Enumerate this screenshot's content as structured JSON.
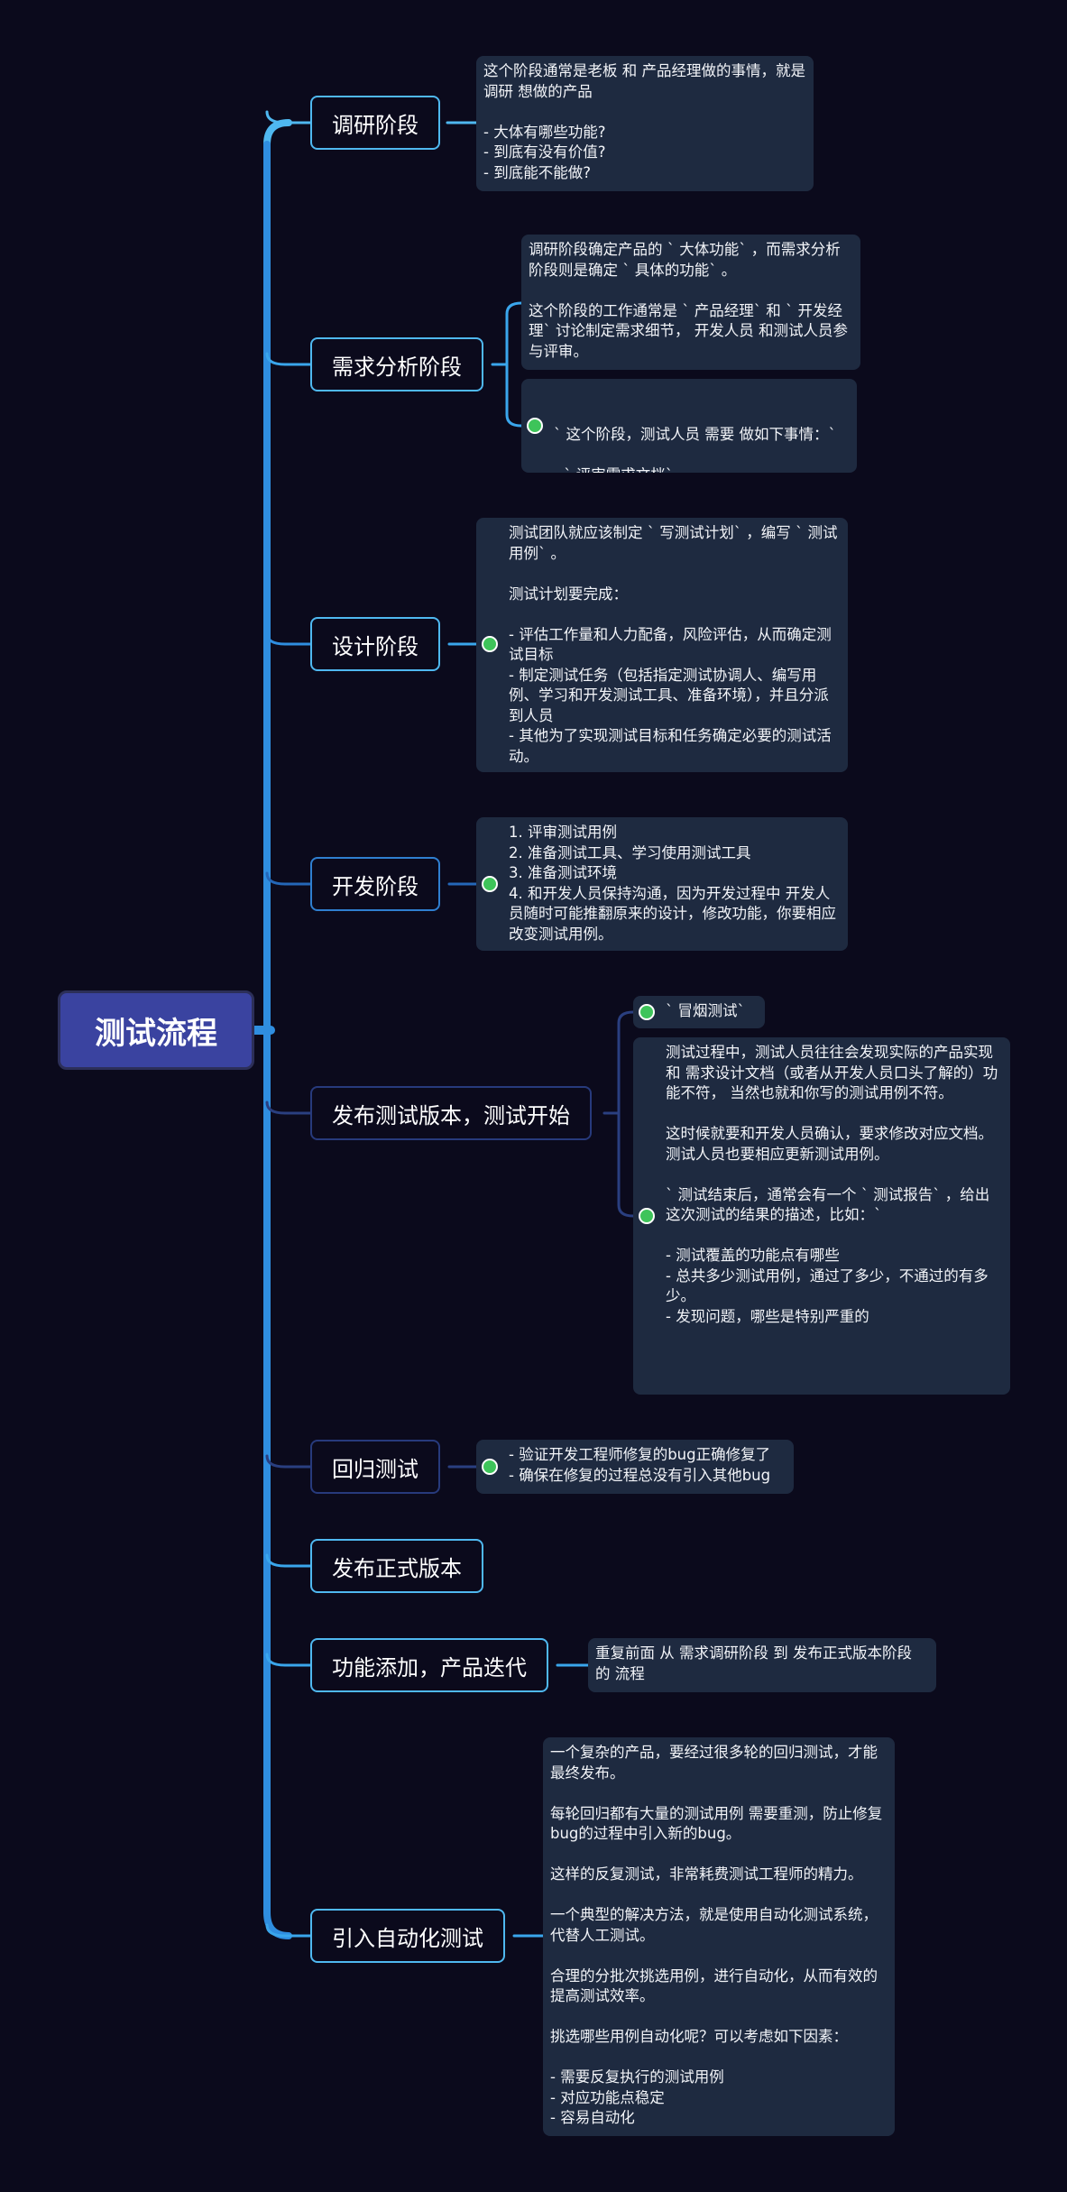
{
  "root": {
    "title": "测试流程"
  },
  "stages": [
    {
      "label": "调研阶段",
      "notes": [
        {
          "text": "这个阶段通常是老板 和 产品经理做的事情，就是调研 想做的产品\n\n- 大体有哪些功能?\n- 到底有没有价值?\n- 到底能不能做?",
          "marker": false
        }
      ]
    },
    {
      "label": "需求分析阶段",
      "notes": [
        {
          "text": "调研阶段确定产品的 ` 大体功能` ，而需求分析阶段则是确定 ` 具体的功能` 。\n\n这个阶段的工作通常是 ` 产品经理` 和 ` 开发经理` 讨论制定需求细节， 开发人员 和测试人员参与评审。",
          "marker": false
        },
        {
          "text": "` 这个阶段，测试人员 需要 做如下事情：`\n\n- ` 评审需求文档`\n- ` 整理测试需求`",
          "marker": true
        }
      ]
    },
    {
      "label": "设计阶段",
      "notes": [
        {
          "text": "测试团队就应该制定 ` 写测试计划` ，编写 ` 测试用例` 。\n\n测试计划要完成：\n\n- 评估工作量和人力配备，风险评估，从而确定测试目标\n- 制定测试任务（包括指定测试协调人、编写用例、学习和开发测试工具、准备环境），并且分派到人员\n- 其他为了实现测试目标和任务确定必要的测试活动。",
          "marker": true
        }
      ]
    },
    {
      "label": "开发阶段",
      "notes": [
        {
          "text": "1. 评审测试用例\n2. 准备测试工具、学习使用测试工具\n3. 准备测试环境\n4. 和开发人员保持沟通，因为开发过程中 开发人员随时可能推翻原来的设计，修改功能，你要相应改变测试用例。",
          "marker": true
        }
      ]
    },
    {
      "label": "发布测试版本，测试开始",
      "notes": [
        {
          "text": "` 冒烟测试`",
          "marker": true
        },
        {
          "text": "测试过程中，测试人员往往会发现实际的产品实现 和 需求设计文档（或者从开发人员口头了解的）功能不符， 当然也就和你写的测试用例不符。\n\n这时候就要和开发人员确认，要求修改对应文档。测试人员也要相应更新测试用例。\n\n` 测试结束后，通常会有一个 ` 测试报告` ，给出这次测试的结果的描述，比如：`\n\n- 测试覆盖的功能点有哪些\n- 总共多少测试用例，通过了多少，不通过的有多少。\n- 发现问题，哪些是特别严重的",
          "marker": true
        }
      ]
    },
    {
      "label": "回归测试",
      "notes": [
        {
          "text": "- 验证开发工程师修复的bug正确修复了\n- 确保在修复的过程总没有引入其他bug",
          "marker": true
        }
      ]
    },
    {
      "label": "发布正式版本",
      "notes": []
    },
    {
      "label": "功能添加，产品迭代",
      "notes": [
        {
          "text": "重复前面 从 需求调研阶段 到 发布正式版本阶段 的 流程",
          "marker": false
        }
      ]
    },
    {
      "label": "引入自动化测试",
      "notes": [
        {
          "text": "一个复杂的产品，要经过很多轮的回归测试，才能最终发布。\n\n每轮回归都有大量的测试用例 需要重测，防止修复bug的过程中引入新的bug。\n\n这样的反复测试，非常耗费测试工程师的精力。\n\n一个典型的解决方法，就是使用自动化测试系统，代替人工测试。\n\n合理的分批次挑选用例，进行自动化，从而有效的提高测试效率。\n\n挑选哪些用例自动化呢？可以考虑如下因素：\n\n- 需要反复执行的测试用例\n- 对应功能点稳定\n- 容易自动化",
          "marker": false
        }
      ]
    }
  ],
  "colors": {
    "background": "#0b0a1c",
    "root_fill": "#3a43a0",
    "note_fill": "#1e2a40",
    "marker": "#3ec45a"
  }
}
